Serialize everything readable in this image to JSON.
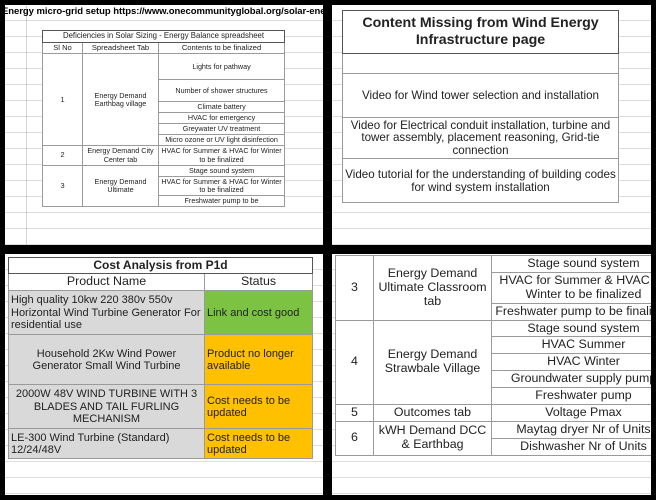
{
  "page": {
    "layout": "four-panel-collage",
    "background_color": "#000000"
  },
  "panel_top_left": {
    "caption": "Energy micro-grid setup https://www.onecommunityglobal.org/solar-energy",
    "table": {
      "title": "Deficiencies in Solar Sizing - Energy Balance spreadsheet",
      "columns": [
        "Sl No",
        "Spreadsheet Tab",
        "Contents to be finalized"
      ],
      "rows": [
        {
          "no": "1",
          "tab": "Energy Demand Earthbag village",
          "items": [
            "Lights for pathway",
            "Number of shower structures",
            "Climate battery",
            "HVAC for emergency",
            "Greywater UV treatment",
            "Micro ozone or UV light disinfection"
          ]
        },
        {
          "no": "2",
          "tab": "Energy Demand City Center tab",
          "items": [
            "HVAC for Summer & HVAC for Winter to be finalized"
          ]
        },
        {
          "no": "3",
          "tab": "Energy Demand Ultimate",
          "items": [
            "Stage sound system",
            "HVAC for Summer & HVAC for Winter to be finalized",
            "Freshwater pump to be"
          ]
        }
      ]
    }
  },
  "panel_top_right": {
    "table": {
      "title": "Content Missing from Wind Energy Infrastructure page",
      "rows": [
        "",
        "Video for Wind tower selection and installation",
        "Video for Electrical conduit installation, turbine and tower assembly, placement reasoning, Grid-tie connection",
        "Video tutorial for the understanding of building codes for wind system installation"
      ]
    }
  },
  "panel_bottom_left": {
    "table": {
      "title": "Cost Analysis from P1d",
      "columns": [
        "Product Name",
        "Status"
      ],
      "rows": [
        {
          "product": "High quality 10kw 220 380v 550v Horizontal Wind Turbine Generator For residential use",
          "status": "Link and cost good",
          "status_color": "#7cc344",
          "align": "left"
        },
        {
          "product": "Household 2Kw Wind Power Generator Small Wind Turbine",
          "status": "Product no longer available",
          "status_color": "#ffc000",
          "align": "center"
        },
        {
          "product": "2000W 48V WIND TURBINE WITH 3 BLADES AND TAIL FURLING MECHANISM",
          "status": "Cost needs to be updated",
          "status_color": "#ffc000",
          "align": "center"
        },
        {
          "product": "LE-300 Wind Turbine (Standard) 12/24/48V",
          "status": "Cost needs to be updated",
          "status_color": "#ffc000",
          "align": "left"
        }
      ]
    }
  },
  "panel_bottom_right": {
    "table": {
      "rows": [
        {
          "no": "3",
          "tab": "Energy Demand Ultimate Classroom tab",
          "items": [
            "Stage sound system",
            "HVAC for Summer & HVAC for Winter to be finalized",
            "Freshwater pump to be finalized"
          ]
        },
        {
          "no": "4",
          "tab": "Energy Demand Strawbale Village",
          "items": [
            "Stage sound system",
            "HVAC Summer",
            "HVAC Winter",
            "Groundwater supply pump",
            "Freshwater pump"
          ]
        },
        {
          "no": "5",
          "tab": "Outcomes tab",
          "items": [
            "Voltage Pmax"
          ]
        },
        {
          "no": "6",
          "tab": "kWH Demand DCC & Earthbag",
          "items": [
            "Maytag dryer Nr of Units",
            "Dishwasher Nr of Units"
          ]
        }
      ]
    }
  }
}
